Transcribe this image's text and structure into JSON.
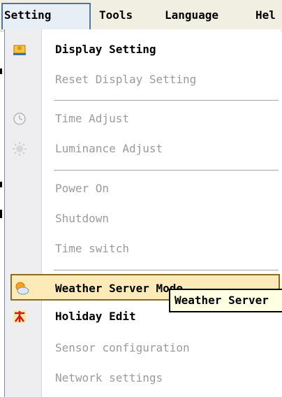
{
  "menubar": {
    "items": [
      {
        "label": "Setting"
      },
      {
        "label": "Tools"
      },
      {
        "label": "Language"
      },
      {
        "label": "Hel"
      }
    ]
  },
  "menu": {
    "display_setting": {
      "label": "Display Setting",
      "icon": "display-icon"
    },
    "reset_display_setting": {
      "label": "Reset Display Setting"
    },
    "time_adjust": {
      "label": "Time Adjust",
      "icon": "clock-icon"
    },
    "luminance_adjust": {
      "label": "Luminance Adjust",
      "icon": "sun-icon"
    },
    "power_on": {
      "label": "Power On"
    },
    "shutdown": {
      "label": "Shutdown"
    },
    "time_switch": {
      "label": "Time switch"
    },
    "weather_server_mode": {
      "label": "Weather Server Mode",
      "icon": "weather-icon"
    },
    "holiday_edit": {
      "label": "Holiday Edit",
      "icon": "holiday-icon"
    },
    "sensor_configuration": {
      "label": "Sensor configuration"
    },
    "network_settings": {
      "label": "Network settings"
    }
  },
  "tooltip": {
    "text": "Weather Server"
  },
  "colors": {
    "highlight_bg": "#fcebb8",
    "highlight_border": "#8a6a1e",
    "disabled_text": "#9a9aa0",
    "tooltip_bg": "#ffffe1",
    "menubar_bg": "#f1efe2"
  }
}
